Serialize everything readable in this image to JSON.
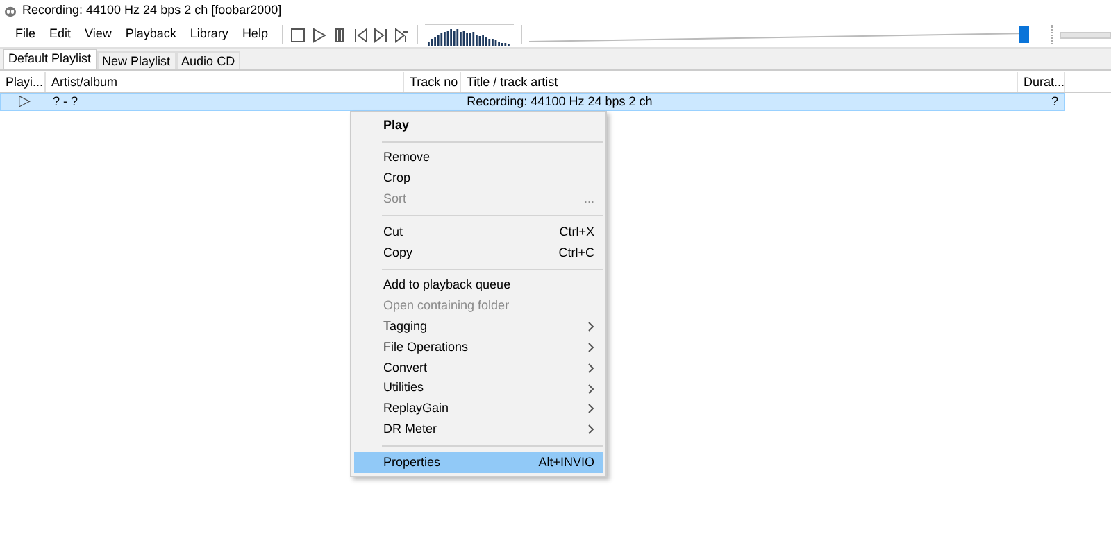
{
  "window": {
    "title": "Recording: 44100 Hz 24 bps 2 ch  [foobar2000]"
  },
  "menu_bar": [
    "File",
    "Edit",
    "View",
    "Playback",
    "Library",
    "Help"
  ],
  "volume": {
    "level": 0.99
  },
  "tabs": [
    {
      "label": "Default Playlist",
      "selected": true
    },
    {
      "label": "New Playlist",
      "selected": false
    },
    {
      "label": "Audio CD",
      "selected": false
    }
  ],
  "table": {
    "columns": [
      "Playi...",
      "Artist/album",
      "Track no",
      "Title / track artist",
      "Durat..."
    ],
    "rows": [
      {
        "selected": true,
        "cells": [
          "▷",
          "? - ?",
          "",
          "Recording: 44100 Hz 24 bps 2 ch",
          "?"
        ]
      }
    ]
  },
  "context_menu": [
    {
      "kind": "item",
      "label": "Play",
      "bold": true,
      "disabled": false,
      "submenu": false,
      "selected": false
    },
    {
      "kind": "separator"
    },
    {
      "kind": "item",
      "label": "Remove",
      "bold": false,
      "disabled": false,
      "submenu": false,
      "selected": false
    },
    {
      "kind": "item",
      "label": "Crop",
      "bold": false,
      "disabled": false,
      "submenu": false,
      "selected": false
    },
    {
      "kind": "item",
      "label": "Sort",
      "shortcut": "...",
      "bold": false,
      "disabled": true,
      "submenu": false,
      "selected": false
    },
    {
      "kind": "separator"
    },
    {
      "kind": "item",
      "label": "Cut",
      "shortcut": "Ctrl+X",
      "bold": false,
      "disabled": false,
      "submenu": false,
      "selected": false
    },
    {
      "kind": "item",
      "label": "Copy",
      "shortcut": "Ctrl+C",
      "bold": false,
      "disabled": false,
      "submenu": false,
      "selected": false
    },
    {
      "kind": "separator"
    },
    {
      "kind": "item",
      "label": "Add to playback queue",
      "bold": false,
      "disabled": false,
      "submenu": false,
      "selected": false
    },
    {
      "kind": "item",
      "label": "Open containing folder",
      "bold": false,
      "disabled": true,
      "submenu": false,
      "selected": false
    },
    {
      "kind": "item",
      "label": "Tagging",
      "bold": false,
      "disabled": false,
      "submenu": true,
      "selected": false
    },
    {
      "kind": "item",
      "label": "File Operations",
      "bold": false,
      "disabled": false,
      "submenu": true,
      "selected": false
    },
    {
      "kind": "item",
      "label": "Convert",
      "bold": false,
      "disabled": false,
      "submenu": true,
      "selected": false
    },
    {
      "kind": "item",
      "label": "Utilities",
      "bold": false,
      "disabled": false,
      "submenu": true,
      "selected": false
    },
    {
      "kind": "item",
      "label": "ReplayGain",
      "bold": false,
      "disabled": false,
      "submenu": true,
      "selected": false
    },
    {
      "kind": "item",
      "label": "DR Meter",
      "bold": false,
      "disabled": false,
      "submenu": true,
      "selected": false
    },
    {
      "kind": "separator"
    },
    {
      "kind": "item",
      "label": "Properties",
      "shortcut": "Alt+INVIO",
      "bold": false,
      "disabled": false,
      "submenu": false,
      "selected": true
    }
  ]
}
